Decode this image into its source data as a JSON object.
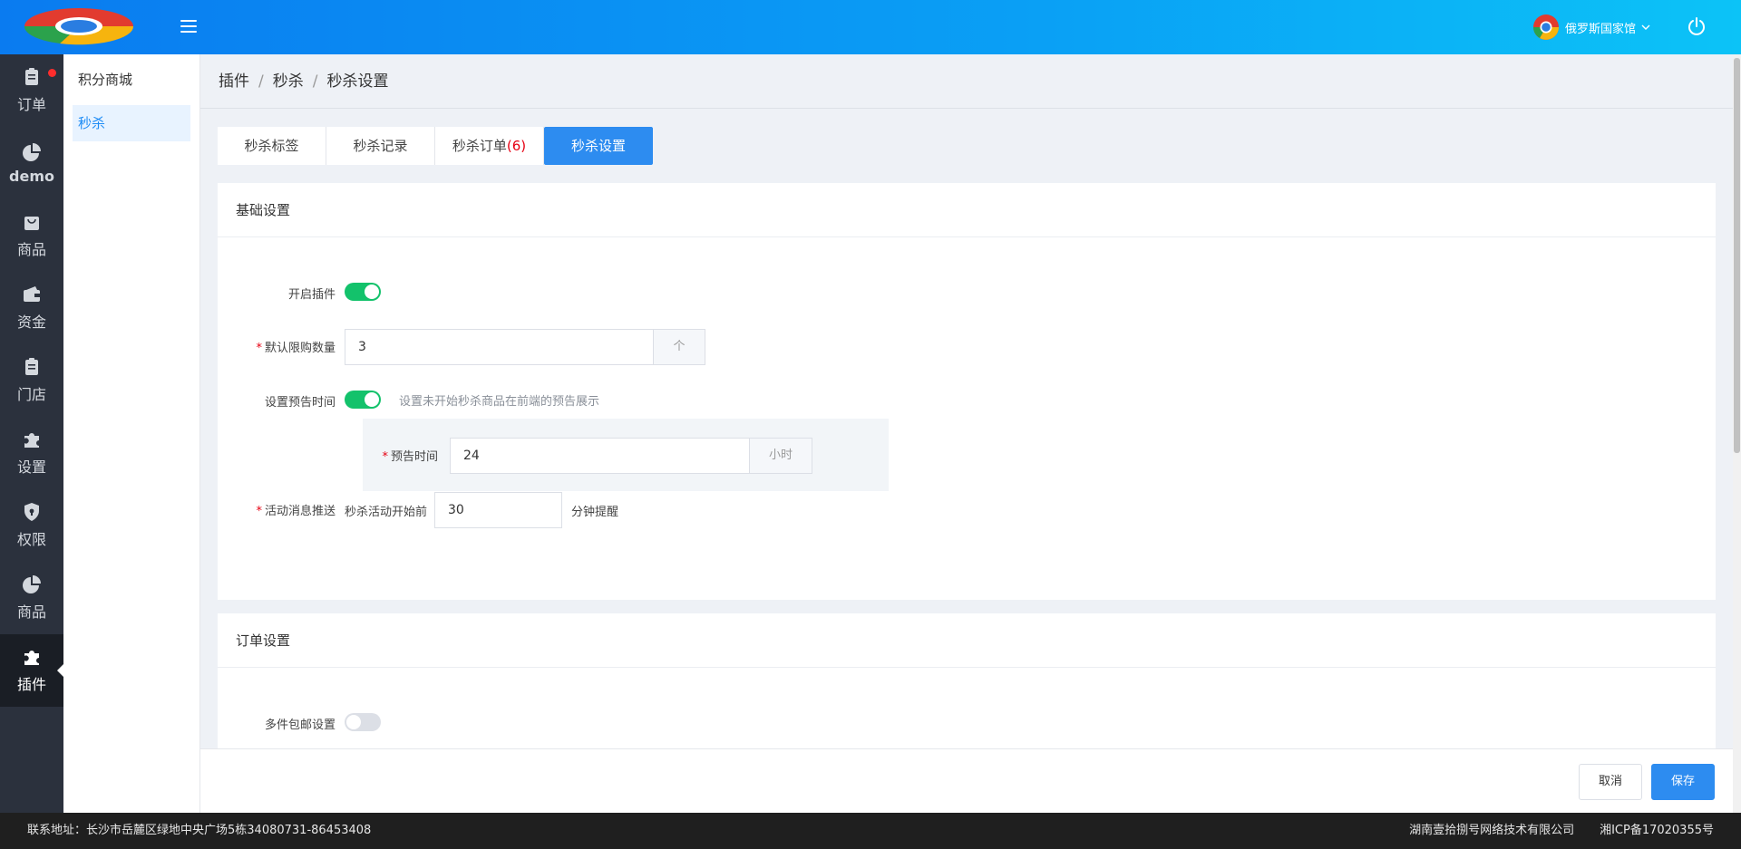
{
  "header": {
    "user_name": "俄罗斯国家馆"
  },
  "nav": {
    "items": [
      {
        "label": "订单",
        "icon": "clipboard-icon"
      },
      {
        "label": "demo",
        "icon": "pie-chart-icon"
      },
      {
        "label": "商品",
        "icon": "bag-icon"
      },
      {
        "label": "资金",
        "icon": "wallet-icon"
      },
      {
        "label": "门店",
        "icon": "clipboard-icon"
      },
      {
        "label": "设置",
        "icon": "puzzle-icon"
      },
      {
        "label": "权限",
        "icon": "shield-icon"
      },
      {
        "label": "商品",
        "icon": "pie-chart-icon"
      },
      {
        "label": "插件",
        "icon": "puzzle-icon"
      }
    ]
  },
  "subnav": {
    "items": [
      "积分商城",
      "秒杀"
    ]
  },
  "breadcrumb": [
    "插件",
    "秒杀",
    "秒杀设置"
  ],
  "tabs": [
    {
      "label": "秒杀标签"
    },
    {
      "label": "秒杀记录"
    },
    {
      "label": "秒杀订单",
      "count": "(6)"
    },
    {
      "label": "秒杀设置"
    }
  ],
  "basic": {
    "title": "基础设置",
    "enable_label": "开启插件",
    "limit_label": "默认限购数量",
    "limit_value": "3",
    "limit_unit": "个",
    "preview_label": "设置预告时间",
    "preview_hint": "设置未开始秒杀商品在前端的预告展示",
    "preview_time_label": "预告时间",
    "preview_time_value": "24",
    "preview_time_unit": "小时",
    "push_label": "活动消息推送",
    "push_prefix": "秒杀活动开始前",
    "push_value": "30",
    "push_suffix": "分钟提醒"
  },
  "order": {
    "title": "订单设置",
    "multi_ship_label": "多件包邮设置"
  },
  "actions": {
    "cancel": "取消",
    "save": "保存"
  },
  "footer": {
    "address": "联系地址：长沙市岳麓区绿地中央广场5栋34080731-86453408",
    "company": "湖南壹拾捌号网络技术有限公司",
    "icp": "湘ICP备17020355号"
  }
}
